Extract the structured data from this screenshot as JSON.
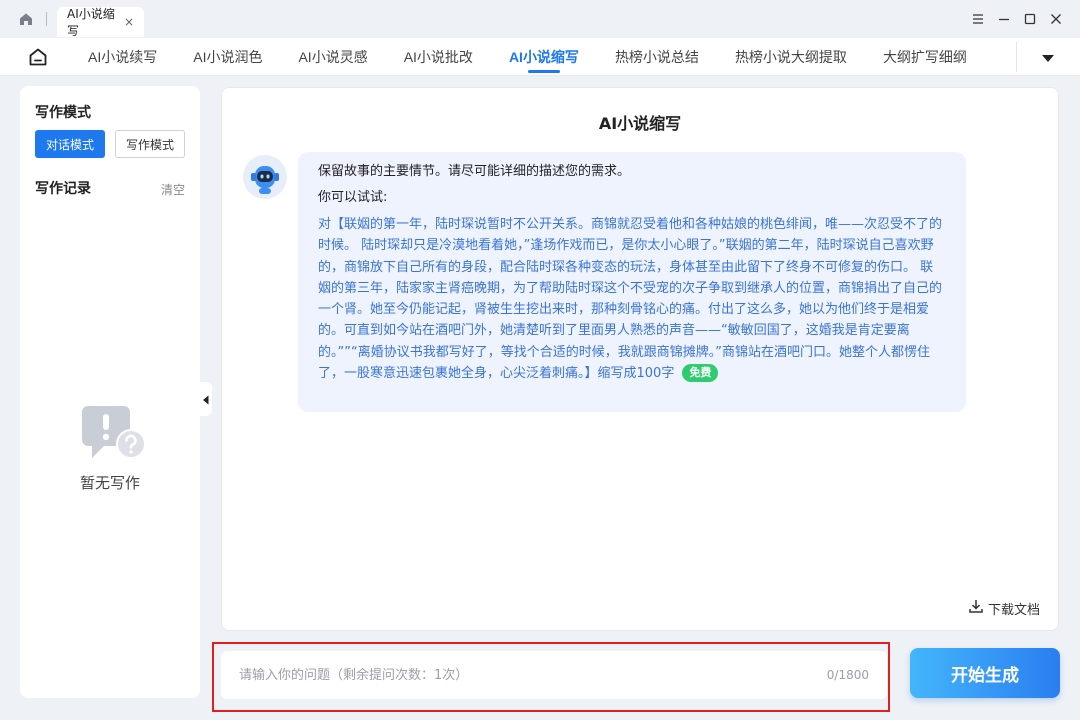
{
  "window": {
    "tab_title": "AI小说缩写",
    "tab_close": "×"
  },
  "nav": {
    "items": [
      {
        "label": "AI小说续写"
      },
      {
        "label": "AI小说润色"
      },
      {
        "label": "AI小说灵感"
      },
      {
        "label": "AI小说批改"
      },
      {
        "label": "AI小说缩写",
        "active": true
      },
      {
        "label": "热榜小说总结"
      },
      {
        "label": "热榜小说大纲提取"
      },
      {
        "label": "大纲扩写细纲"
      }
    ]
  },
  "sidebar": {
    "mode_title": "写作模式",
    "mode_dialog": "对话模式",
    "mode_writing": "写作模式",
    "record_title": "写作记录",
    "clear_label": "清空",
    "empty_text": "暂无写作"
  },
  "main": {
    "title": "AI小说缩写",
    "intro": "保留故事的主要情节。请尽可能详细的描述您的需求。",
    "try_label": "你可以试试:",
    "example_text": "对【联姻的第一年，陆时琛说暂时不公开关系。商锦就忍受着他和各种姑娘的桃色绯闻，唯——次忍受不了的时候。 陆时琛却只是冷漠地看着她，”逢场作戏而已，是你太小心眼了。”联姻的第二年，陆时琛说自己喜欢野的，商锦放下自己所有的身段，配合陆时琛各种变态的玩法，身体甚至由此留下了终身不可修复的伤口。 联姻的第三年，陆家家主肾癌晚期，为了帮助陆时琛这个不受宠的次子争取到继承人的位置，商锦捐出了自己的一个肾。她至今仍能记起，肾被生生挖出来时，那种刻骨铭心的痛。付出了这么多，她以为他们终于是相爱的。可直到如今站在酒吧门外，她清楚听到了里面男人熟悉的声音——“敏敏回国了，这婚我是肯定要离的。””“离婚协议书我都写好了，等找个合适的时候，我就跟商锦摊牌。”商锦站在酒吧门口。她整个人都愣住了，一股寒意迅速包裹她全身，心尖泛着刺痛。】缩写成100字",
    "free_badge": "免费",
    "download_label": "下载文档"
  },
  "input": {
    "placeholder": "请输入你的问题（剩余提问次数：1次）",
    "value": "",
    "counter": "0/1800"
  },
  "generate_button": "开始生成",
  "colors": {
    "accent": "#1e78ee",
    "example_text": "#3a74d6",
    "free_badge": "#2ecb6f",
    "highlight_outline": "#e01f1f"
  }
}
